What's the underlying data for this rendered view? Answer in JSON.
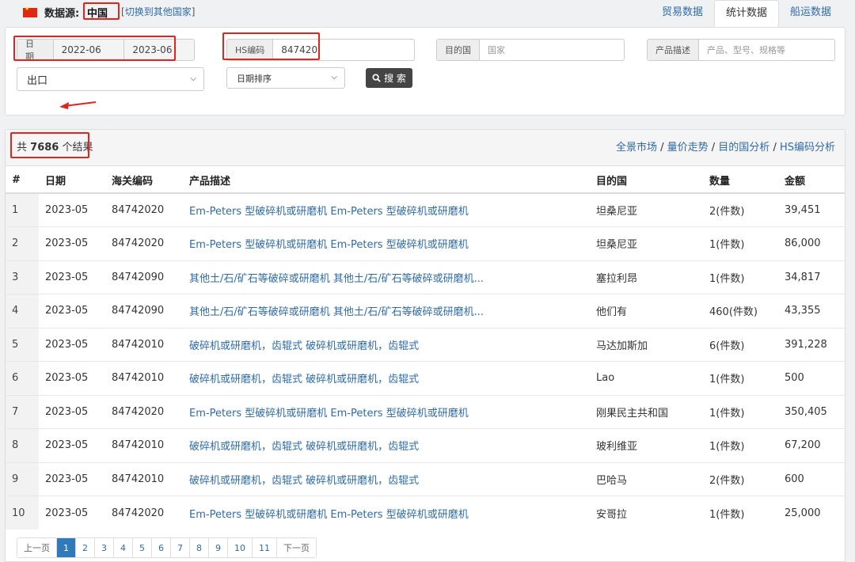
{
  "header": {
    "source_label": "数据源:",
    "source_value": "中国",
    "switch_link": "切换到其他国家",
    "tabs": [
      "贸易数据",
      "统计数据",
      "船运数据"
    ]
  },
  "filters": {
    "date_label": "日 期",
    "date_from": "2022-06",
    "date_to": "2023-06",
    "hs_label": "HS编码",
    "hs_value": "847420",
    "dest_label": "目的国",
    "dest_placeholder": "国家",
    "desc_label": "产品描述",
    "desc_placeholder": "产品、型号、规格等",
    "trade_type": "出口",
    "sort": "日期排序",
    "search_button": "搜 索"
  },
  "results": {
    "count_prefix": "共",
    "count": "7686",
    "count_suffix": "个结果",
    "analysis_links": [
      "全景市场",
      "量价走势",
      "目的国分析",
      "HS编码分析"
    ],
    "columns": [
      "#",
      "日期",
      "海关编码",
      "产品描述",
      "目的国",
      "数量",
      "金额"
    ],
    "rows": [
      {
        "n": "1",
        "date": "2023-05",
        "code": "84742020",
        "desc": "Em-Peters 型破碎机或研磨机 Em-Peters 型破碎机或研磨机",
        "country": "坦桑尼亚",
        "qty": "2(件数)",
        "amount": "39,451"
      },
      {
        "n": "2",
        "date": "2023-05",
        "code": "84742020",
        "desc": "Em-Peters 型破碎机或研磨机 Em-Peters 型破碎机或研磨机",
        "country": "坦桑尼亚",
        "qty": "1(件数)",
        "amount": "86,000"
      },
      {
        "n": "3",
        "date": "2023-05",
        "code": "84742090",
        "desc": "其他土/石/矿石等破碎或研磨机 其他土/石/矿石等破碎或研磨机...",
        "country": "塞拉利昂",
        "qty": "1(件数)",
        "amount": "34,817"
      },
      {
        "n": "4",
        "date": "2023-05",
        "code": "84742090",
        "desc": "其他土/石/矿石等破碎或研磨机 其他土/石/矿石等破碎或研磨机...",
        "country": "他们有",
        "qty": "460(件数)",
        "amount": "43,355"
      },
      {
        "n": "5",
        "date": "2023-05",
        "code": "84742010",
        "desc": "破碎机或研磨机，齿辊式 破碎机或研磨机，齿辊式",
        "country": "马达加斯加",
        "qty": "6(件数)",
        "amount": "391,228"
      },
      {
        "n": "6",
        "date": "2023-05",
        "code": "84742010",
        "desc": "破碎机或研磨机，齿辊式 破碎机或研磨机，齿辊式",
        "country": "Lao",
        "qty": "1(件数)",
        "amount": "500"
      },
      {
        "n": "7",
        "date": "2023-05",
        "code": "84742020",
        "desc": "Em-Peters 型破碎机或研磨机 Em-Peters 型破碎机或研磨机",
        "country": "刚果民主共和国",
        "qty": "1(件数)",
        "amount": "350,405"
      },
      {
        "n": "8",
        "date": "2023-05",
        "code": "84742010",
        "desc": "破碎机或研磨机，齿辊式 破碎机或研磨机，齿辊式",
        "country": "玻利维亚",
        "qty": "1(件数)",
        "amount": "67,200"
      },
      {
        "n": "9",
        "date": "2023-05",
        "code": "84742010",
        "desc": "破碎机或研磨机，齿辊式 破碎机或研磨机，齿辊式",
        "country": "巴哈马",
        "qty": "2(件数)",
        "amount": "600"
      },
      {
        "n": "10",
        "date": "2023-05",
        "code": "84742020",
        "desc": "Em-Peters 型破碎机或研磨机 Em-Peters 型破碎机或研磨机",
        "country": "安哥拉",
        "qty": "1(件数)",
        "amount": "25,000"
      }
    ]
  },
  "pagination": {
    "prev": "上一页",
    "pages": [
      "1",
      "2",
      "3",
      "4",
      "5",
      "6",
      "7",
      "8",
      "9",
      "10",
      "11"
    ],
    "current": "1",
    "next": "下一页"
  },
  "colors": {
    "link": "#2f6ba8",
    "highlight_box": "#e5231c",
    "active_page": "#2f7ab8",
    "search_button": "#444444"
  }
}
